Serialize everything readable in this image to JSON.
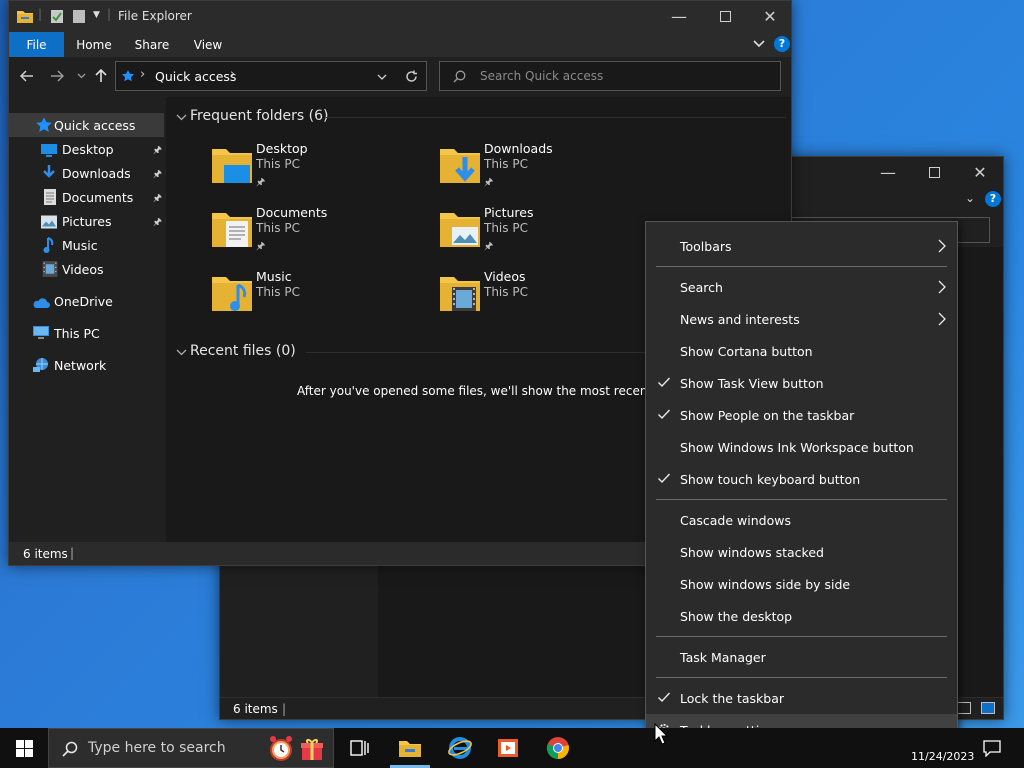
{
  "explorer_front": {
    "title": "File Explorer",
    "tabs": {
      "file": "File",
      "home": "Home",
      "view": "View"
    },
    "address": {
      "location": "Quick access"
    },
    "search": {
      "placeholder": "Search Quick access"
    },
    "nav": [
      {
        "label": "Quick access",
        "icon": "star-icon",
        "pinned": false
      },
      {
        "label": "Desktop",
        "icon": "desktop-icon",
        "pinned": true
      },
      {
        "label": "Downloads",
        "icon": "downloads-icon",
        "pinned": true
      },
      {
        "label": "Documents",
        "icon": "documents-icon",
        "pinned": true
      },
      {
        "label": "Pictures",
        "icon": "pictures-icon",
        "pinned": true
      },
      {
        "label": "Music",
        "icon": "music-icon",
        "pinned": false
      },
      {
        "label": "Videos",
        "icon": "videos-icon",
        "pinned": false
      },
      {
        "label": "OneDrive",
        "icon": "onedrive-icon",
        "pinned": false
      },
      {
        "label": "This PC",
        "icon": "this-pc-icon",
        "pinned": false
      },
      {
        "label": "Network",
        "icon": "network-icon",
        "pinned": false
      }
    ],
    "frequent_header": "Frequent folders (6)",
    "folders": [
      {
        "name": "Desktop",
        "location": "This PC",
        "pinned": true
      },
      {
        "name": "Downloads",
        "location": "This PC",
        "pinned": true
      },
      {
        "name": "Documents",
        "location": "This PC",
        "pinned": true
      },
      {
        "name": "Pictures",
        "location": "This PC",
        "pinned": true
      },
      {
        "name": "Music",
        "location": "This PC",
        "pinned": false
      },
      {
        "name": "Videos",
        "location": "This PC",
        "pinned": false
      }
    ],
    "recent_header": "Recent files (0)",
    "recent_empty": "After you've opened some files, we'll show the most recent ones h",
    "status": "6 items"
  },
  "explorer_back": {
    "status": "6 items"
  },
  "context_menu": {
    "items": [
      {
        "label": "Toolbars",
        "checked": false,
        "submenu": true
      },
      {
        "label": "Search",
        "checked": false,
        "submenu": true
      },
      {
        "label": "News and interests",
        "checked": false,
        "submenu": true
      },
      {
        "label": "Show Cortana button",
        "checked": false,
        "submenu": false
      },
      {
        "label": "Show Task View button",
        "checked": true,
        "submenu": false
      },
      {
        "label": "Show People on the taskbar",
        "checked": true,
        "submenu": false
      },
      {
        "label": "Show Windows Ink Workspace button",
        "checked": false,
        "submenu": false
      },
      {
        "label": "Show touch keyboard button",
        "checked": true,
        "submenu": false
      },
      {
        "label": "Cascade windows",
        "checked": false,
        "submenu": false
      },
      {
        "label": "Show windows stacked",
        "checked": false,
        "submenu": false
      },
      {
        "label": "Show windows side by side",
        "checked": false,
        "submenu": false
      },
      {
        "label": "Show the desktop",
        "checked": false,
        "submenu": false
      },
      {
        "label": "Task Manager",
        "checked": false,
        "submenu": false
      },
      {
        "label": "Lock the taskbar",
        "checked": true,
        "submenu": false
      },
      {
        "label": "Taskbar settings",
        "checked": false,
        "submenu": false,
        "hovered": true
      }
    ]
  },
  "taskbar": {
    "search_placeholder": "Type here to search",
    "date": "11/24/2023"
  },
  "colors": {
    "accent": "#0078d7",
    "folder_yellow": "#f3c64a",
    "taskbar": "#101010"
  }
}
